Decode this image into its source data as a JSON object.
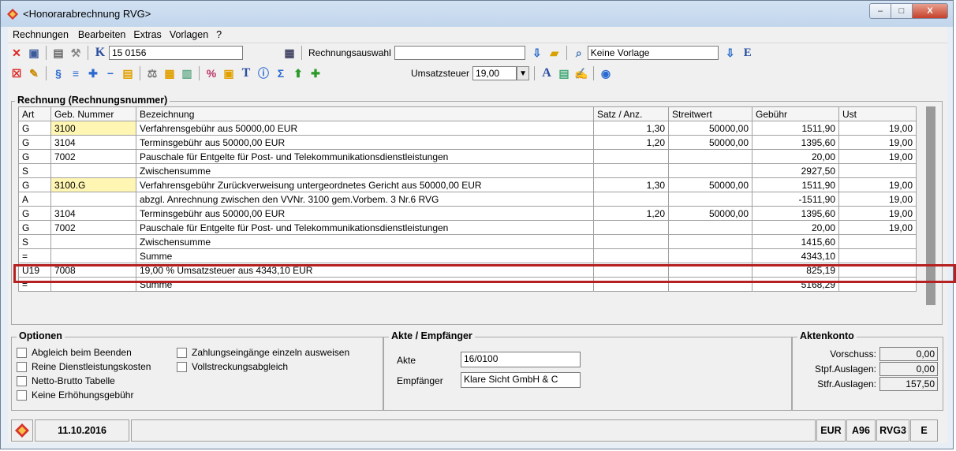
{
  "window": {
    "title": "<Honorarabrechnung RVG>",
    "controls": {
      "minimize": "–",
      "maximize": "□",
      "close": "X"
    }
  },
  "menu": [
    {
      "label": "Rechnungen"
    },
    {
      "label": "Bearbeiten"
    },
    {
      "label": "Extras"
    },
    {
      "label": "Vorlagen"
    },
    {
      "label": "?"
    }
  ],
  "toolbar1": {
    "k_label": "K",
    "invoice_number": "15 0156",
    "selection_label": "Rechnungsauswahl",
    "selection_value": "",
    "template_value": "Keine Vorlage",
    "e_label": "E"
  },
  "toolbar2": {
    "tax_label": "Umsatzsteuer",
    "tax_value": "19,00",
    "a_label": "A",
    "t_label": "T",
    "sigma_label": "Σ",
    "percent_label": "%",
    "para_label": "§"
  },
  "grid": {
    "title": "Rechnung (Rechnungsnummer)",
    "columns": [
      "Art",
      "Geb. Nummer",
      "Bezeichnung",
      "Satz / Anz.",
      "Streitwert",
      "Gebühr",
      "Ust"
    ],
    "rows": [
      {
        "art": "G",
        "nr": "3100",
        "bez": "Verfahrensgebühr aus 50000,00 EUR",
        "satz": "1,30",
        "streit": "50000,00",
        "geb": "1511,90",
        "ust": "19,00",
        "yellow": true
      },
      {
        "art": "G",
        "nr": "3104",
        "bez": "Terminsgebühr aus 50000,00 EUR",
        "satz": "1,20",
        "streit": "50000,00",
        "geb": "1395,60",
        "ust": "19,00",
        "yellow": false
      },
      {
        "art": "G",
        "nr": "7002",
        "bez": "Pauschale für Entgelte für Post- und Telekommunikationsdienstleistungen",
        "satz": "",
        "streit": "",
        "geb": "20,00",
        "ust": "19,00",
        "yellow": false
      },
      {
        "art": "S",
        "nr": "",
        "bez": "Zwischensumme",
        "satz": "",
        "streit": "",
        "geb": "2927,50",
        "ust": "",
        "yellow": false
      },
      {
        "art": "G",
        "nr": "3100.G",
        "bez": "Verfahrensgebühr Zurückverweisung untergeordnetes Gericht aus 50000,00 EUR",
        "satz": "1,30",
        "streit": "50000,00",
        "geb": "1511,90",
        "ust": "19,00",
        "yellow": true
      },
      {
        "art": "A",
        "nr": "",
        "bez": "abzgl. Anrechnung zwischen den VVNr. 3100 gem.Vorbem. 3 Nr.6 RVG",
        "satz": "",
        "streit": "",
        "geb": "-1511,90",
        "ust": "19,00",
        "yellow": false
      },
      {
        "art": "G",
        "nr": "3104",
        "bez": "Terminsgebühr aus 50000,00 EUR",
        "satz": "1,20",
        "streit": "50000,00",
        "geb": "1395,60",
        "ust": "19,00",
        "yellow": false
      },
      {
        "art": "G",
        "nr": "7002",
        "bez": "Pauschale für Entgelte für Post- und Telekommunikationsdienstleistungen",
        "satz": "",
        "streit": "",
        "geb": "20,00",
        "ust": "19,00",
        "yellow": false
      },
      {
        "art": "S",
        "nr": "",
        "bez": "Zwischensumme",
        "satz": "",
        "streit": "",
        "geb": "1415,60",
        "ust": "",
        "yellow": false
      },
      {
        "art": "=",
        "nr": "",
        "bez": "Summe",
        "satz": "",
        "streit": "",
        "geb": "4343,10",
        "ust": "",
        "yellow": false
      },
      {
        "art": "U19",
        "nr": "7008",
        "bez": "19,00 % Umsatzsteuer aus  4343,10 EUR",
        "satz": "",
        "streit": "",
        "geb": "825,19",
        "ust": "",
        "yellow": false
      },
      {
        "art": "=",
        "nr": "",
        "bez": "Summe",
        "satz": "",
        "streit": "",
        "geb": "5168,29",
        "ust": "",
        "yellow": false
      }
    ]
  },
  "options": {
    "title": "Optionen",
    "items": [
      "Abgleich beim Beenden",
      "Reine Dienstleistungskosten",
      "Netto-Brutto Tabelle",
      "Keine Erhöhungsgebühr",
      "Zahlungseingänge einzeln ausweisen",
      "Vollstreckungsabgleich"
    ]
  },
  "akte": {
    "title": "Akte / Empfänger",
    "akte_label": "Akte",
    "akte_value": "16/0100",
    "empf_label": "Empfänger",
    "empf_value": "Klare Sicht GmbH & C"
  },
  "aktenkonto": {
    "title": "Aktenkonto",
    "rows": [
      {
        "label": "Vorschuss:",
        "value": "0,00"
      },
      {
        "label": "Stpf.Auslagen:",
        "value": "0,00"
      },
      {
        "label": "Stfr.Auslagen:",
        "value": "157,50"
      }
    ]
  },
  "status": {
    "date": "11.10.2016",
    "cells": [
      "EUR",
      "A96",
      "RVG3",
      "E"
    ]
  }
}
